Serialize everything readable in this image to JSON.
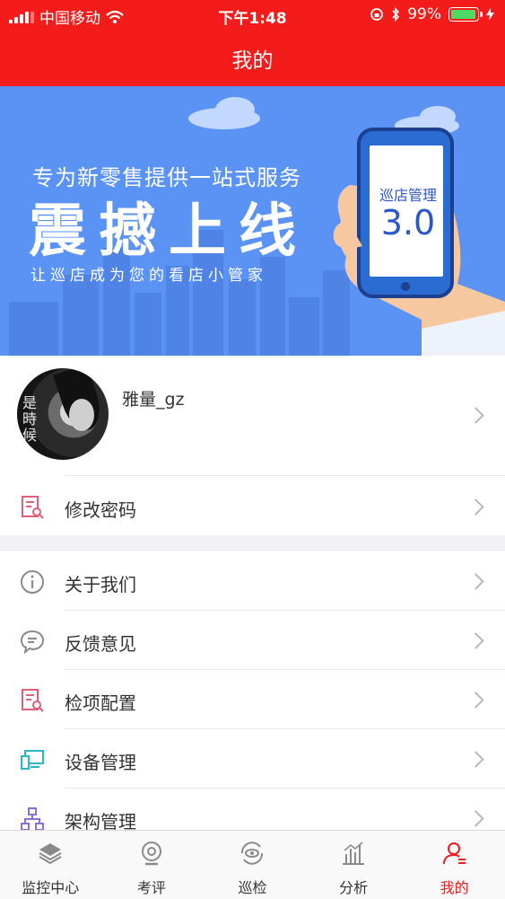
{
  "status_bar": {
    "carrier": "中国移动",
    "time": "下午1:48",
    "battery": "99%",
    "battery_level": 0.99
  },
  "nav": {
    "title": "我的"
  },
  "banner": {
    "subtitle": "专为新零售提供一站式服务",
    "title": "震撼上线",
    "slogan": "让巡店成为您的看店小管家",
    "phone_label": "巡店管理",
    "phone_version": "3.0"
  },
  "profile": {
    "username": "雅量_gz",
    "avatar_text": "是時候"
  },
  "menu": [
    {
      "label": "修改密码",
      "icon": "document-search-icon",
      "color": "#e0607a"
    },
    {
      "label": "关于我们",
      "icon": "info-icon",
      "color": "#8a8a8a"
    },
    {
      "label": "反馈意见",
      "icon": "chat-icon",
      "color": "#8a8a8a"
    },
    {
      "label": "检项配置",
      "icon": "document-search-icon",
      "color": "#e0607a"
    },
    {
      "label": "设备管理",
      "icon": "devices-icon",
      "color": "#2bb7c6"
    },
    {
      "label": "架构管理",
      "icon": "org-chart-icon",
      "color": "#8a6fd8"
    }
  ],
  "tabs": [
    {
      "label": "监控中心",
      "icon": "layers-icon"
    },
    {
      "label": "考评",
      "icon": "camera-icon"
    },
    {
      "label": "巡检",
      "icon": "eye-refresh-icon"
    },
    {
      "label": "分析",
      "icon": "bar-chart-icon"
    },
    {
      "label": "我的",
      "icon": "user-icon",
      "active": true
    }
  ],
  "colors": {
    "brand": "#f41b1b",
    "banner": "#5b93f5",
    "text": "#333333"
  }
}
